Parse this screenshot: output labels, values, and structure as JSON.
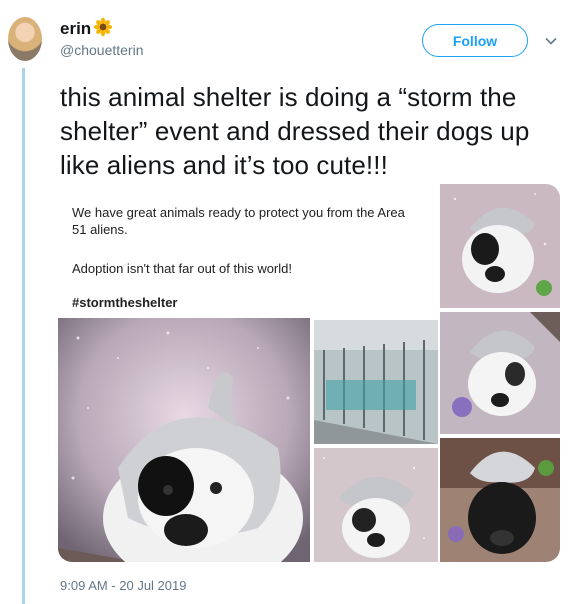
{
  "user": {
    "name": "erin",
    "handle": "@chouetterin",
    "follow_label": "Follow"
  },
  "tweet": {
    "text": "this animal shelter is doing a “storm the shelter” event and dressed their dogs up like aliens and it’s too cute!!!",
    "timestamp": "9:09 AM - 20 Jul 2019"
  },
  "media": {
    "caption_line1": "We have great animals ready to protect you from the Area 51 aliens.",
    "caption_line2": "Adoption isn't that far out of this world!",
    "hashtag": "#stormtheshelter"
  },
  "colors": {
    "accent": "#1da1f2",
    "thread_line": "#a8d4f2",
    "muted": "#657786"
  }
}
